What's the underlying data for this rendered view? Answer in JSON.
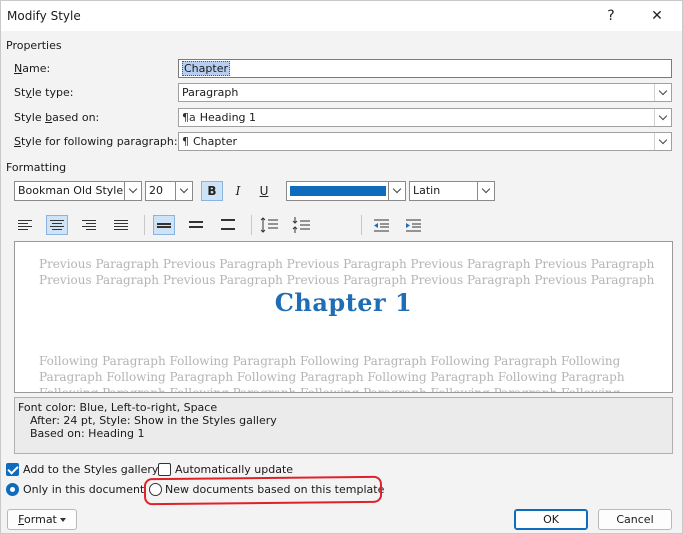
{
  "window": {
    "title": "Modify Style",
    "help_glyph": "?",
    "close_glyph": "✕"
  },
  "properties": {
    "group_label": "Properties",
    "name_label_pre": "",
    "name_label_u": "N",
    "name_label_post": "ame:",
    "name_value": "Chapter",
    "style_type_label_pre": "St",
    "style_type_label_u": "y",
    "style_type_label_post": "le type:",
    "style_type_value": "Paragraph",
    "based_on_label_pre": "Style ",
    "based_on_label_u": "b",
    "based_on_label_post": "ased on:",
    "based_on_icon": "¶a",
    "based_on_value": "Heading 1",
    "following_label_pre": "",
    "following_label_u": "S",
    "following_label_post": "tyle for following paragraph:",
    "following_icon": "¶",
    "following_value": "Chapter"
  },
  "formatting": {
    "group_label": "Formatting",
    "font": "Bookman Old Style",
    "size": "20",
    "bold": "B",
    "italic": "I",
    "underline": "U",
    "font_color": "#0f6cbd",
    "script": "Latin"
  },
  "preview": {
    "previous_line_1": "Previous Paragraph Previous Paragraph Previous Paragraph Previous Paragraph Previous Paragraph",
    "previous_line_2": "Previous Paragraph Previous Paragraph Previous Paragraph Previous Paragraph Previous Paragraph",
    "sample_text": "Chapter 1",
    "following_line_1": "Following Paragraph Following Paragraph Following Paragraph Following Paragraph Following",
    "following_line_2": "Paragraph Following Paragraph Following Paragraph Following Paragraph Following Paragraph",
    "following_line_3": "Following Paragraph Following Paragraph Following Paragraph Following Paragraph Following",
    "sample_color": "#1f6db5"
  },
  "description": {
    "line_1": "Font color: Blue, Left-to-right, Space",
    "line_2": "After:  24 pt, Style: Show in the Styles gallery",
    "line_3": "Based on: Heading 1"
  },
  "options": {
    "add_to_gallery": "Add to the Styles gallery",
    "auto_update": "Automatically update",
    "only_this_document": "Only in this document",
    "new_documents": "New documents based on this template"
  },
  "buttons": {
    "format_pre": "F",
    "format_post": "ormat",
    "ok": "OK",
    "cancel": "Cancel"
  }
}
